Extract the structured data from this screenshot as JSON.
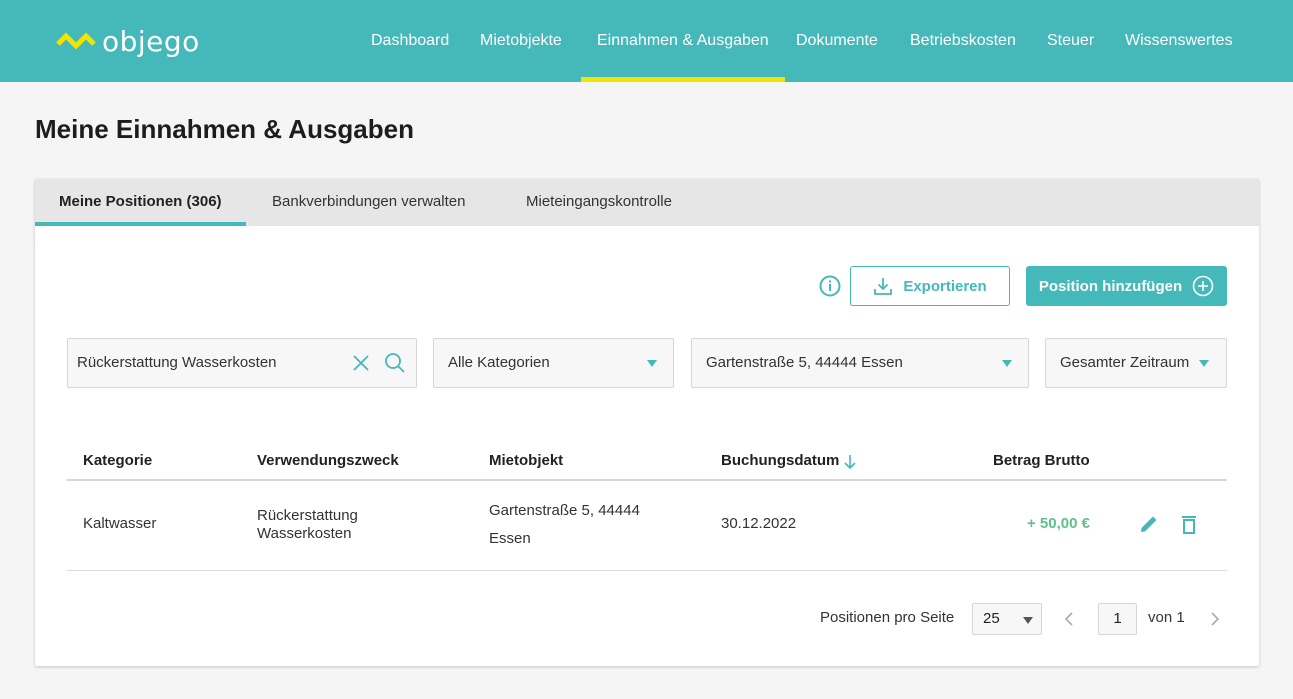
{
  "app": {
    "logo_text": "objego"
  },
  "nav": {
    "items": [
      "Dashboard",
      "Mietobjekte",
      "Einnahmen & Ausgaben",
      "Dokumente",
      "Betriebskosten",
      "Steuer",
      "Wissenswertes"
    ],
    "active": "Einnahmen & Ausgaben"
  },
  "page": {
    "title": "Meine Einnahmen & Ausgaben"
  },
  "tabs": {
    "items": [
      "Meine Positionen (306)",
      "Bankverbindungen verwalten",
      "Mieteingangskontrolle"
    ],
    "active": "Meine Positionen (306)"
  },
  "toolbar": {
    "export_label": "Exportieren",
    "add_label": "Position hinzufügen"
  },
  "filters": {
    "search_value": "Rückerstattung Wasserkosten",
    "category": "Alle Kategorien",
    "object": "Gartenstraße 5, 44444 Essen",
    "period": "Gesamter Zeitraum"
  },
  "table": {
    "headers": [
      "Kategorie",
      "Verwendungszweck",
      "Mietobjekt",
      "Buchungsdatum",
      "Betrag Brutto"
    ],
    "sorted_by": "Buchungsdatum",
    "rows": [
      {
        "category": "Kaltwasser",
        "purpose_line1": "Rückerstattung",
        "purpose_line2": "Wasserkosten",
        "object_line1": "Gartenstraße 5, 44444",
        "object_line2": "Essen",
        "date": "30.12.2022",
        "amount": "+ 50,00 €"
      }
    ]
  },
  "pagination": {
    "label": "Positionen pro Seite",
    "per_page": "25",
    "current_page": "1",
    "of_label": "von 1"
  },
  "colors": {
    "brand": "#45b8ba",
    "accent": "#f1e500",
    "positive": "#5fc08a"
  }
}
